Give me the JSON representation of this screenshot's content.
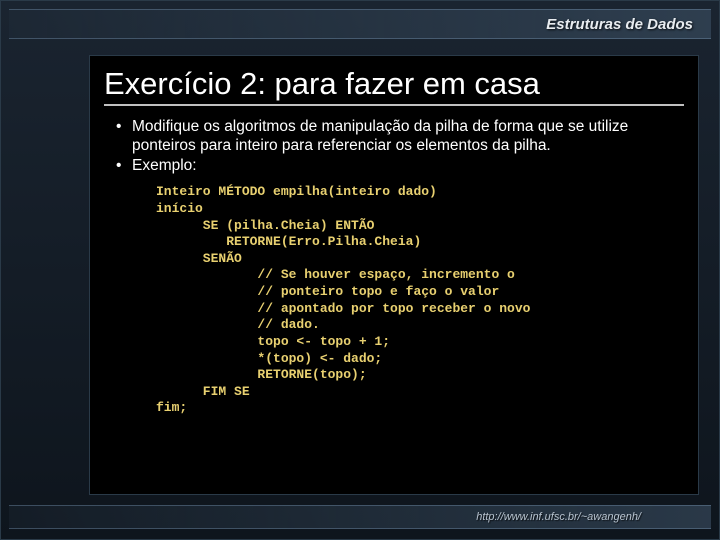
{
  "header": {
    "title": "Estruturas de Dados"
  },
  "content": {
    "title": "Exercício 2: para fazer em casa",
    "bullets": [
      "Modifique os algoritmos de manipulação da pilha de forma que se utilize ponteiros para inteiro para referenciar os elementos da pilha.",
      "Exemplo:"
    ],
    "code": "Inteiro MÉTODO empilha(inteiro dado)\ninício\n      SE (pilha.Cheia) ENTÃO\n         RETORNE(Erro.Pilha.Cheia)\n      SENÃO\n             // Se houver espaço, incremento o\n             // ponteiro topo e faço o valor\n             // apontado por topo receber o novo\n             // dado.\n             topo <- topo + 1;\n             *(topo) <- dado;\n             RETORNE(topo);\n      FIM SE\nfim;"
  },
  "footer": {
    "url": "http://www.inf.ufsc.br/~awangenh/"
  }
}
